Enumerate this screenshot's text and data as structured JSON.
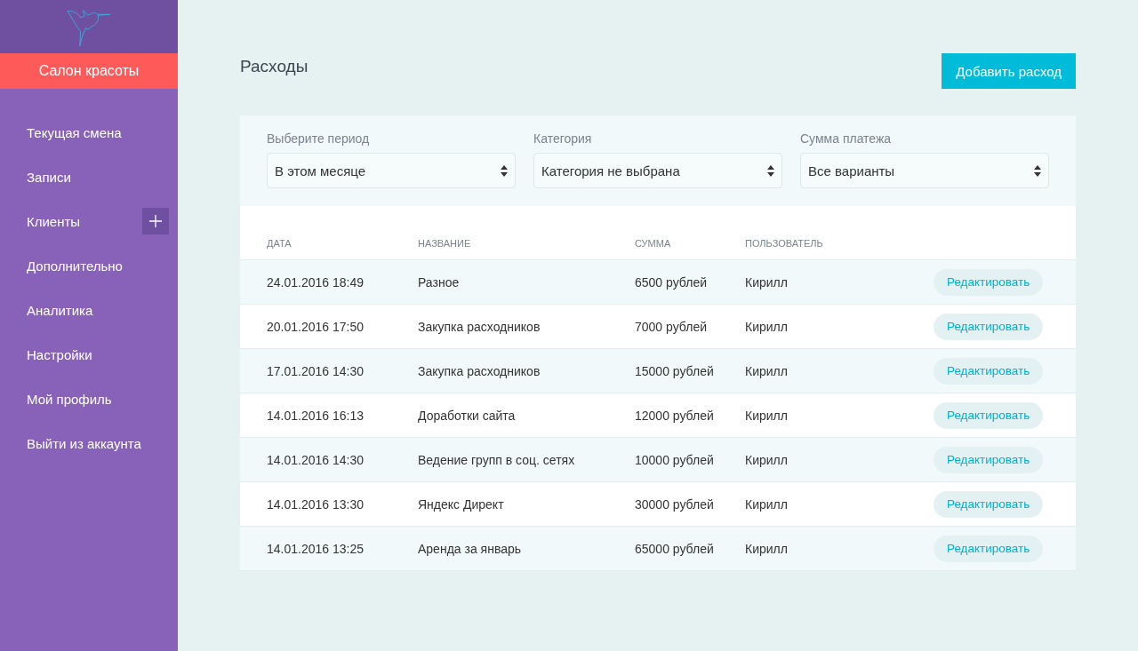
{
  "sidebar": {
    "salon": "Салон красоты",
    "items": [
      {
        "label": "Текущая смена",
        "add_button": false
      },
      {
        "label": "Записи",
        "add_button": false
      },
      {
        "label": "Клиенты",
        "add_button": true
      },
      {
        "label": "Дополнительно",
        "add_button": false
      },
      {
        "label": "Аналитика",
        "add_button": false
      },
      {
        "label": "Настройки",
        "add_button": false
      },
      {
        "label": "Мой профиль",
        "add_button": false
      },
      {
        "label": "Выйти из аккаунта",
        "add_button": false
      }
    ]
  },
  "page": {
    "title": "Расходы",
    "add_button": "Добавить расход"
  },
  "filters": [
    {
      "label": "Выберите период",
      "value": "В этом месяце"
    },
    {
      "label": "Категория",
      "value": "Категория не выбрана"
    },
    {
      "label": "Сумма платежа",
      "value": "Все варианты"
    }
  ],
  "table": {
    "columns": [
      "ДАТА",
      "НАЗВАНИЕ",
      "СУММА",
      "ПОЛЬЗОВАТЕЛЬ"
    ],
    "rows": [
      {
        "date": "24.01.2016 18:49",
        "name": "Разное",
        "sum": "6500 рублей",
        "user": "Кирилл",
        "action": "Редактировать"
      },
      {
        "date": "20.01.2016 17:50",
        "name": "Закупка расходников",
        "sum": "7000 рублей",
        "user": "Кирилл",
        "action": "Редактировать"
      },
      {
        "date": "17.01.2016 14:30",
        "name": "Закупка расходников",
        "sum": "15000 рублей",
        "user": "Кирилл",
        "action": "Редактировать"
      },
      {
        "date": "14.01.2016 16:13",
        "name": "Доработки сайта",
        "sum": "12000 рублей",
        "user": "Кирилл",
        "action": "Редактировать"
      },
      {
        "date": "14.01.2016 14:30",
        "name": "Ведение групп в соц. сетях",
        "sum": "10000 рублей",
        "user": "Кирилл",
        "action": "Редактировать"
      },
      {
        "date": "14.01.2016 13:30",
        "name": "Яндекс Директ",
        "sum": "30000 рублей",
        "user": "Кирилл",
        "action": "Редактировать"
      },
      {
        "date": "14.01.2016 13:25",
        "name": "Аренда за январь",
        "sum": "65000 рублей",
        "user": "Кирилл",
        "action": "Редактировать"
      }
    ]
  }
}
